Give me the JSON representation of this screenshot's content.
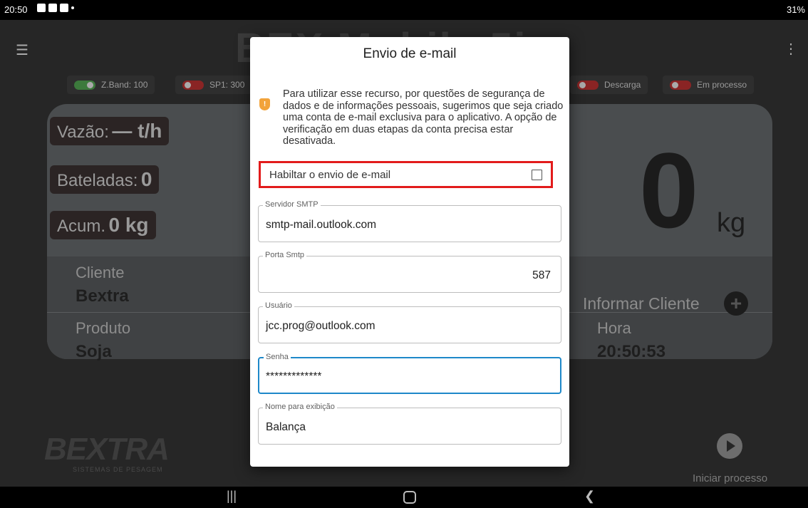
{
  "status_bar": {
    "time": "20:50",
    "battery": "31%"
  },
  "app": {
    "title": "BEX Mobile 5i",
    "chips": [
      {
        "label": "Z.Band: 100",
        "state": "on"
      },
      {
        "label": "SP1: 300",
        "state": "off"
      },
      {
        "label": "Descarga",
        "state": "off"
      },
      {
        "label": "Em processo",
        "state": "off"
      }
    ],
    "stats": {
      "flow_label": "Vazão:",
      "flow_value": "— t/h",
      "batches_label": "Bateladas:",
      "batches_value": "0",
      "accum_label": "Acum.",
      "accum_value": "0 kg"
    },
    "weight": {
      "value": "0",
      "unit": "kg"
    },
    "client_label": "Cliente",
    "client_value": "Bextra",
    "inform_client": "Informar Cliente",
    "product_label": "Produto",
    "product_value": "Soja",
    "time_label": "Hora",
    "time_value": "20:50:53",
    "logo": "BEXTRA",
    "logo_sub": "SISTEMAS DE PESAGEM",
    "start_process": "Iniciar processo"
  },
  "dialog": {
    "title": "Envio de e-mail",
    "notice": "Para utilizar esse recurso, por questões de segurança de dados e de informações pessoais, sugerimos que seja criado uma conta de e-mail exclusiva para o aplicativo. A opção de verificação em duas etapas da conta precisa estar desativada.",
    "enable_label": "Habiltar o envio de e-mail",
    "enable_checked": false,
    "fields": {
      "smtp_server_label": "Servidor SMTP",
      "smtp_server_value": "smtp-mail.outlook.com",
      "smtp_port_label": "Porta Smtp",
      "smtp_port_value": "587",
      "user_label": "Usuário",
      "user_value": "jcc.prog@outlook.com",
      "password_label": "Senha",
      "password_value": "*************",
      "display_name_label": "Nome para exibição",
      "display_name_value": "Balança"
    }
  },
  "colors": {
    "highlight_border": "#e21b1b",
    "focus_border": "#1e88c9",
    "notice_icon": "#f2a33a"
  }
}
